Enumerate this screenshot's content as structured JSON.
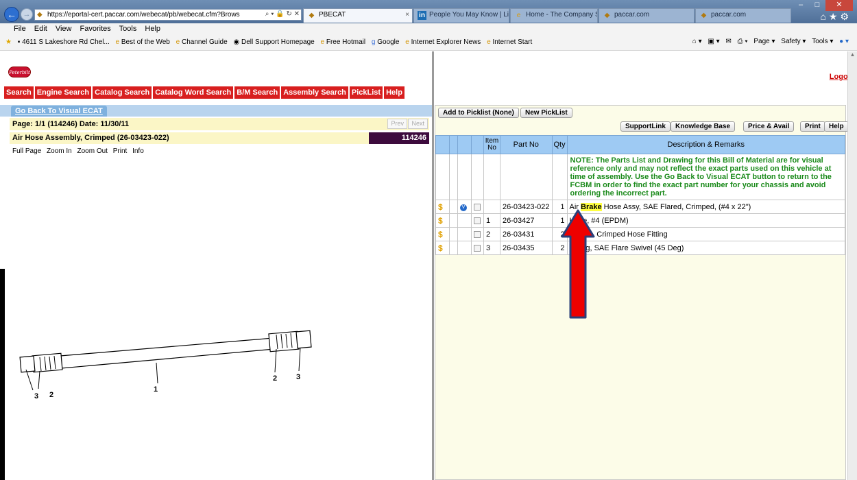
{
  "browser": {
    "url": "https://eportal-cert.paccar.com/webecat/pb/webecat.cfm?Brows",
    "tabs": [
      {
        "label": "PBECAT",
        "active": true
      },
      {
        "label": "People You May Know | Link...",
        "active": false
      },
      {
        "label": "Home - The Company Store",
        "active": false
      },
      {
        "label": "paccar.com",
        "active": false
      },
      {
        "label": "paccar.com",
        "active": false
      }
    ],
    "menu": [
      "File",
      "Edit",
      "View",
      "Favorites",
      "Tools",
      "Help"
    ],
    "favorites": [
      "4611 S Lakeshore Rd Chel...",
      "Best of the Web",
      "Channel Guide",
      "Dell Support Homepage",
      "Free Hotmail",
      "Google",
      "Internet Explorer News",
      "Internet Start"
    ],
    "command_bar": [
      "Page ▾",
      "Safety ▾",
      "Tools ▾"
    ]
  },
  "header": {
    "logo_text": "Peterbilt",
    "logoff": "Logoff",
    "nav": [
      "Search",
      "Engine Search",
      "Catalog Search",
      "Catalog Word Search",
      "B/M Search",
      "Assembly Search",
      "PickList",
      "Help"
    ]
  },
  "left": {
    "go_back": "Go Back To Visual ECAT",
    "page_info": "Page: 1/1 (114246)  Date: 11/30/11",
    "prev": "Prev",
    "next": "Next",
    "title": "Air Hose Assembly, Crimped (26-03423-022)",
    "id": "114246",
    "view_links": [
      "Full Page",
      "Zoom In",
      "Zoom Out",
      "Print",
      "Info"
    ],
    "callouts": [
      "3",
      "2",
      "1",
      "2",
      "3"
    ]
  },
  "right": {
    "add_picklist": "Add to Picklist (None)",
    "new_picklist": "New PickList",
    "support_link": "SupportLink",
    "knowledge_base": "Knowledge Base",
    "price_avail": "Price & Avail",
    "print": "Print",
    "help": "Help",
    "columns": [
      "Item No",
      "Part No",
      "Qty",
      "Description & Remarks"
    ],
    "note": "NOTE: The Parts List and Drawing for this Bill of Material are for visual reference only and may not reflect the exact parts used on this vehicle at time of assembly. Use the Go Back to Visual ECAT button to return to the FCBM in order to find the exact part number for your chassis and avoid ordering the incorrect part.",
    "rows": [
      {
        "item": "",
        "part": "26-03423-022",
        "qty": "1",
        "desc_pre": "Air ",
        "desc_hl": "Brake",
        "desc_post": " Hose Assy, SAE Flared, Crimped, (#4 x 22\")"
      },
      {
        "item": "1",
        "part": "26-03427",
        "qty": "1",
        "desc_pre": "Hose, #4 (EPDM)",
        "desc_hl": "",
        "desc_post": ""
      },
      {
        "item": "2",
        "part": "26-03431",
        "qty": "2",
        "desc_pre": "Sleeve, Crimped Hose Fitting",
        "desc_hl": "",
        "desc_post": ""
      },
      {
        "item": "3",
        "part": "26-03435",
        "qty": "2",
        "desc_pre": "Fitting, SAE Flare Swivel (45 Deg)",
        "desc_hl": "",
        "desc_post": ""
      }
    ]
  },
  "colors": {
    "nav_red": "#d81f1f",
    "header_blue": "#9ecaf3",
    "arrow_red": "#ee0000",
    "arrow_outline": "#2b3f7a"
  }
}
